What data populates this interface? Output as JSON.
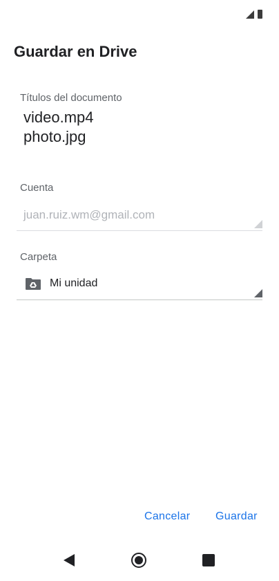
{
  "dialog": {
    "title": "Guardar en Drive"
  },
  "documents": {
    "label": "Títulos del documento",
    "titles": [
      "video.mp4",
      "photo.jpg"
    ]
  },
  "account": {
    "label": "Cuenta",
    "value": "juan.ruiz.wm@gmail.com"
  },
  "folder": {
    "label": "Carpeta",
    "value": "Mi unidad",
    "icon": "drive-folder-icon"
  },
  "actions": {
    "cancel_label": "Cancelar",
    "save_label": "Guardar"
  },
  "colors": {
    "accent": "#1a73e8",
    "icon": "#5f6368"
  }
}
